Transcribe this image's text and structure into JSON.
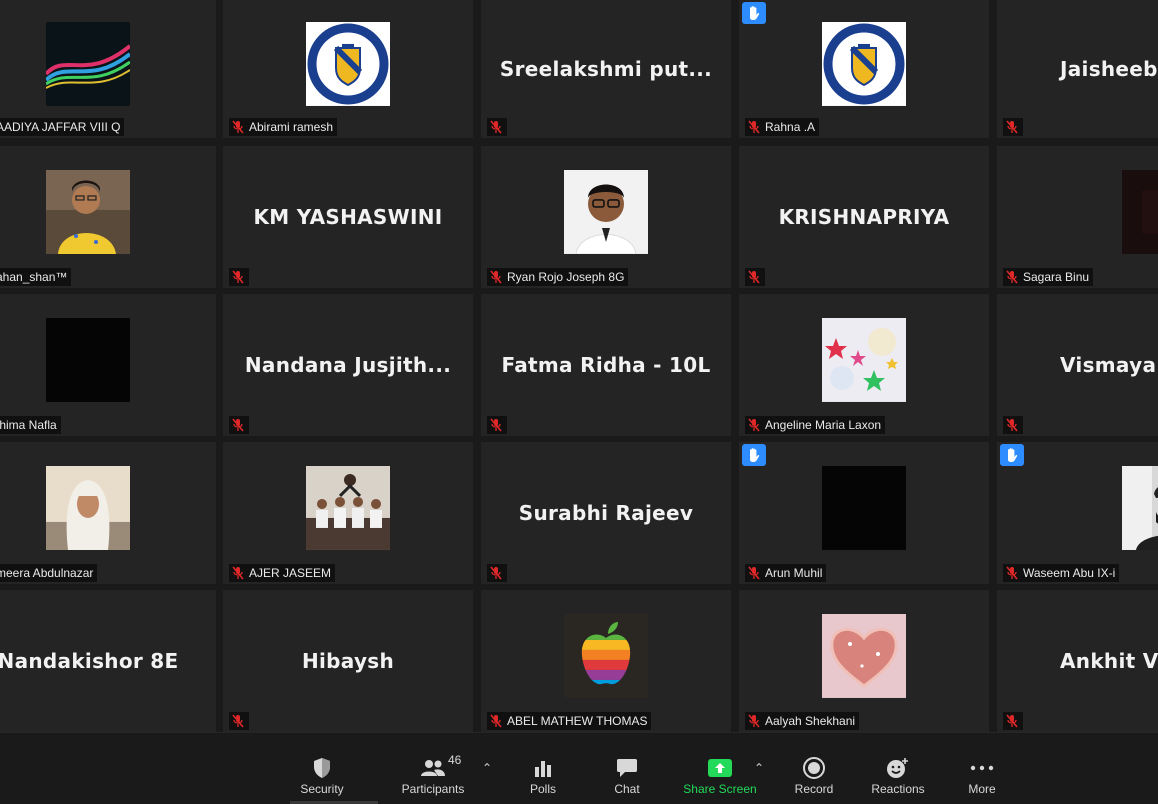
{
  "colors": {
    "background": "#1a1a1a",
    "tile": "#242424",
    "mic_off": "#e02828",
    "raise_hand": "#2d8cff",
    "share_screen": "#23d959"
  },
  "participants": [
    {
      "label": "AADIYA JAFFAR VIII Q",
      "avatar": "abstract-wave",
      "hand": false
    },
    {
      "label": "Abirami ramesh",
      "avatar": "school-logo",
      "hand": false
    },
    {
      "display": "Sreelakshmi  put...",
      "hand": false
    },
    {
      "label": "Rahna .A",
      "avatar": "school-logo",
      "hand": true
    },
    {
      "display": "Jaisheeb",
      "hand": false
    },
    {
      "label": "ahan_shan™",
      "avatar": "boy-yellow-shirt",
      "hand": false
    },
    {
      "display": "KM YASHASWINI",
      "hand": false
    },
    {
      "label": "Ryan Rojo Joseph 8G",
      "avatar": "boy-glasses",
      "hand": false
    },
    {
      "display": "KRISHNAPRIYA",
      "hand": false
    },
    {
      "label": "Sagara Binu",
      "avatar": "dark-photo",
      "hand": false
    },
    {
      "label": "thima Nafla",
      "avatar": "black",
      "hand": false
    },
    {
      "display": "Nandana  Jusjith...",
      "hand": false
    },
    {
      "display": "Fatma Ridha - 10L",
      "hand": false
    },
    {
      "label": "Angeline Maria Laxon",
      "avatar": "stars",
      "hand": false
    },
    {
      "display": "Vismaya",
      "hand": false
    },
    {
      "label": "meera Abdulnazar",
      "avatar": "girl-hijab",
      "hand": false
    },
    {
      "label": "AJER JASEEM",
      "avatar": "group-photo",
      "hand": false
    },
    {
      "display": "Surabhi Rajeev",
      "hand": false
    },
    {
      "label": "Arun Muhil",
      "avatar": "black",
      "hand": true
    },
    {
      "label": "Waseem Abu IX-i",
      "avatar": "man-cap",
      "hand": true
    },
    {
      "display": "Nandakishor 8E",
      "hand": false
    },
    {
      "display": "Hibaysh",
      "hand": false
    },
    {
      "label": "ABEL MATHEW THOMAS",
      "avatar": "rainbow-apple",
      "hand": false
    },
    {
      "label": "Aalyah Shekhani",
      "avatar": "pink-heart",
      "hand": false
    },
    {
      "display": "Ankhit Ve",
      "hand": false
    }
  ],
  "toolbar": {
    "security": {
      "label": "Security",
      "icon": "shield-icon"
    },
    "participants": {
      "label": "Participants",
      "count": "46",
      "icon": "people-icon"
    },
    "polls": {
      "label": "Polls",
      "icon": "bar-chart-icon"
    },
    "chat": {
      "label": "Chat",
      "icon": "chat-bubble-icon"
    },
    "share": {
      "label": "Share Screen",
      "icon": "share-arrow-icon"
    },
    "record": {
      "label": "Record",
      "icon": "record-icon"
    },
    "reactions": {
      "label": "Reactions",
      "icon": "smiley-plus-icon"
    },
    "more": {
      "label": "More",
      "icon": "ellipsis-icon"
    }
  }
}
